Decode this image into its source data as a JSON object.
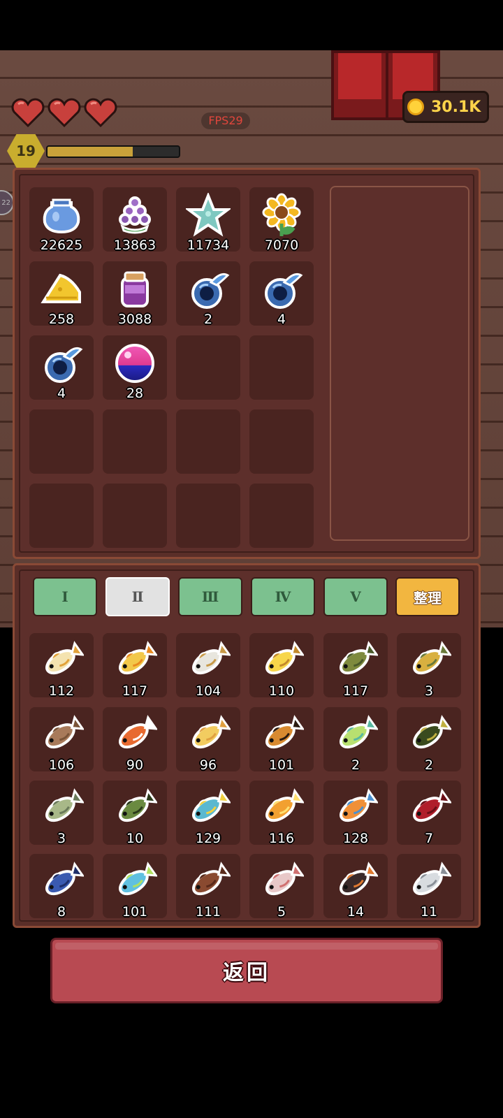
{
  "hud": {
    "fps": "FPS29",
    "coins": "30.1K",
    "level": "19",
    "xp_fraction": 0.65,
    "hearts": 3,
    "side_badge": "22"
  },
  "inventory": {
    "items": [
      {
        "icon": "blue-jar-icon",
        "count": "22625"
      },
      {
        "icon": "grape-bunch-icon",
        "count": "13863"
      },
      {
        "icon": "starfish-icon",
        "count": "11734"
      },
      {
        "icon": "sunflower-icon",
        "count": "7070"
      },
      {
        "icon": "cheese-icon",
        "count": "258"
      },
      {
        "icon": "purple-jar-icon",
        "count": "3088"
      },
      {
        "icon": "blue-potion-icon",
        "count": "2"
      },
      {
        "icon": "blue-potion-icon",
        "count": "4"
      },
      {
        "icon": "blue-potion-icon",
        "count": "4"
      },
      {
        "icon": "magic-orb-icon",
        "count": "28"
      }
    ],
    "empty_slots": 10
  },
  "tabs": [
    {
      "label": "Ⅰ",
      "active": false
    },
    {
      "label": "Ⅱ",
      "active": true
    },
    {
      "label": "Ⅲ",
      "active": false
    },
    {
      "label": "Ⅳ",
      "active": false
    },
    {
      "label": "Ⅴ",
      "active": false
    }
  ],
  "sort_label": "整理",
  "fish": [
    {
      "icon": "white-gold-fish-icon",
      "count": "112",
      "c1": "#f4e3b0",
      "c2": "#e2a23a"
    },
    {
      "icon": "golden-fish-icon",
      "count": "117",
      "c1": "#f2c84a",
      "c2": "#e98a20"
    },
    {
      "icon": "silver-fish-icon",
      "count": "104",
      "c1": "#e8e6de",
      "c2": "#c89a48"
    },
    {
      "icon": "yellow-fish-icon",
      "count": "110",
      "c1": "#f7d64a",
      "c2": "#c48a2a"
    },
    {
      "icon": "olive-fish-icon",
      "count": "117",
      "c1": "#7e8a3e",
      "c2": "#4a5a2a"
    },
    {
      "icon": "yellow-green-fish-icon",
      "count": "3",
      "c1": "#d8b040",
      "c2": "#6a7a3a"
    },
    {
      "icon": "brown-fish-icon",
      "count": "106",
      "c1": "#a87a5a",
      "c2": "#7a5438"
    },
    {
      "icon": "clownfish-icon",
      "count": "90",
      "c1": "#e86a30",
      "c2": "#ffffff"
    },
    {
      "icon": "pale-yellow-fish-icon",
      "count": "96",
      "c1": "#f2cc60",
      "c2": "#e0a040"
    },
    {
      "icon": "tiger-fish-icon",
      "count": "101",
      "c1": "#d88a30",
      "c2": "#2a1a10"
    },
    {
      "icon": "lime-fish-icon",
      "count": "2",
      "c1": "#b8e070",
      "c2": "#58b8a0"
    },
    {
      "icon": "dark-green-fish-icon",
      "count": "2",
      "c1": "#3a4a1e",
      "c2": "#c0b040"
    },
    {
      "icon": "green-gray-fish-icon",
      "count": "3",
      "c1": "#a8b888",
      "c2": "#6a7a5a"
    },
    {
      "icon": "striped-green-fish-icon",
      "count": "10",
      "c1": "#6a8a40",
      "c2": "#2a3a1a"
    },
    {
      "icon": "parrot-fish-icon",
      "count": "129",
      "c1": "#5ab8d0",
      "c2": "#f0d040"
    },
    {
      "icon": "pufferfish-icon",
      "count": "116",
      "c1": "#f2a030",
      "c2": "#ffe070"
    },
    {
      "icon": "orange-blue-fish-icon",
      "count": "128",
      "c1": "#f09038",
      "c2": "#4a90d0"
    },
    {
      "icon": "red-lobster-icon",
      "count": "7",
      "c1": "#b01e2a",
      "c2": "#6a0e16"
    },
    {
      "icon": "blue-fish-icon",
      "count": "8",
      "c1": "#3a5ab0",
      "c2": "#1e2e6a"
    },
    {
      "icon": "rainbow-fish-icon",
      "count": "101",
      "c1": "#60c0e0",
      "c2": "#b0e060"
    },
    {
      "icon": "drumstick-fish-icon",
      "count": "111",
      "c1": "#8a4a30",
      "c2": "#5a2a1a"
    },
    {
      "icon": "pink-eel-icon",
      "count": "5",
      "c1": "#e8c8c8",
      "c2": "#d07070"
    },
    {
      "icon": "dark-fish-icon",
      "count": "14",
      "c1": "#3a2a2a",
      "c2": "#e07a30"
    },
    {
      "icon": "silver-eel-icon",
      "count": "11",
      "c1": "#d8dce0",
      "c2": "#8a9098"
    }
  ],
  "back_label": "返回"
}
